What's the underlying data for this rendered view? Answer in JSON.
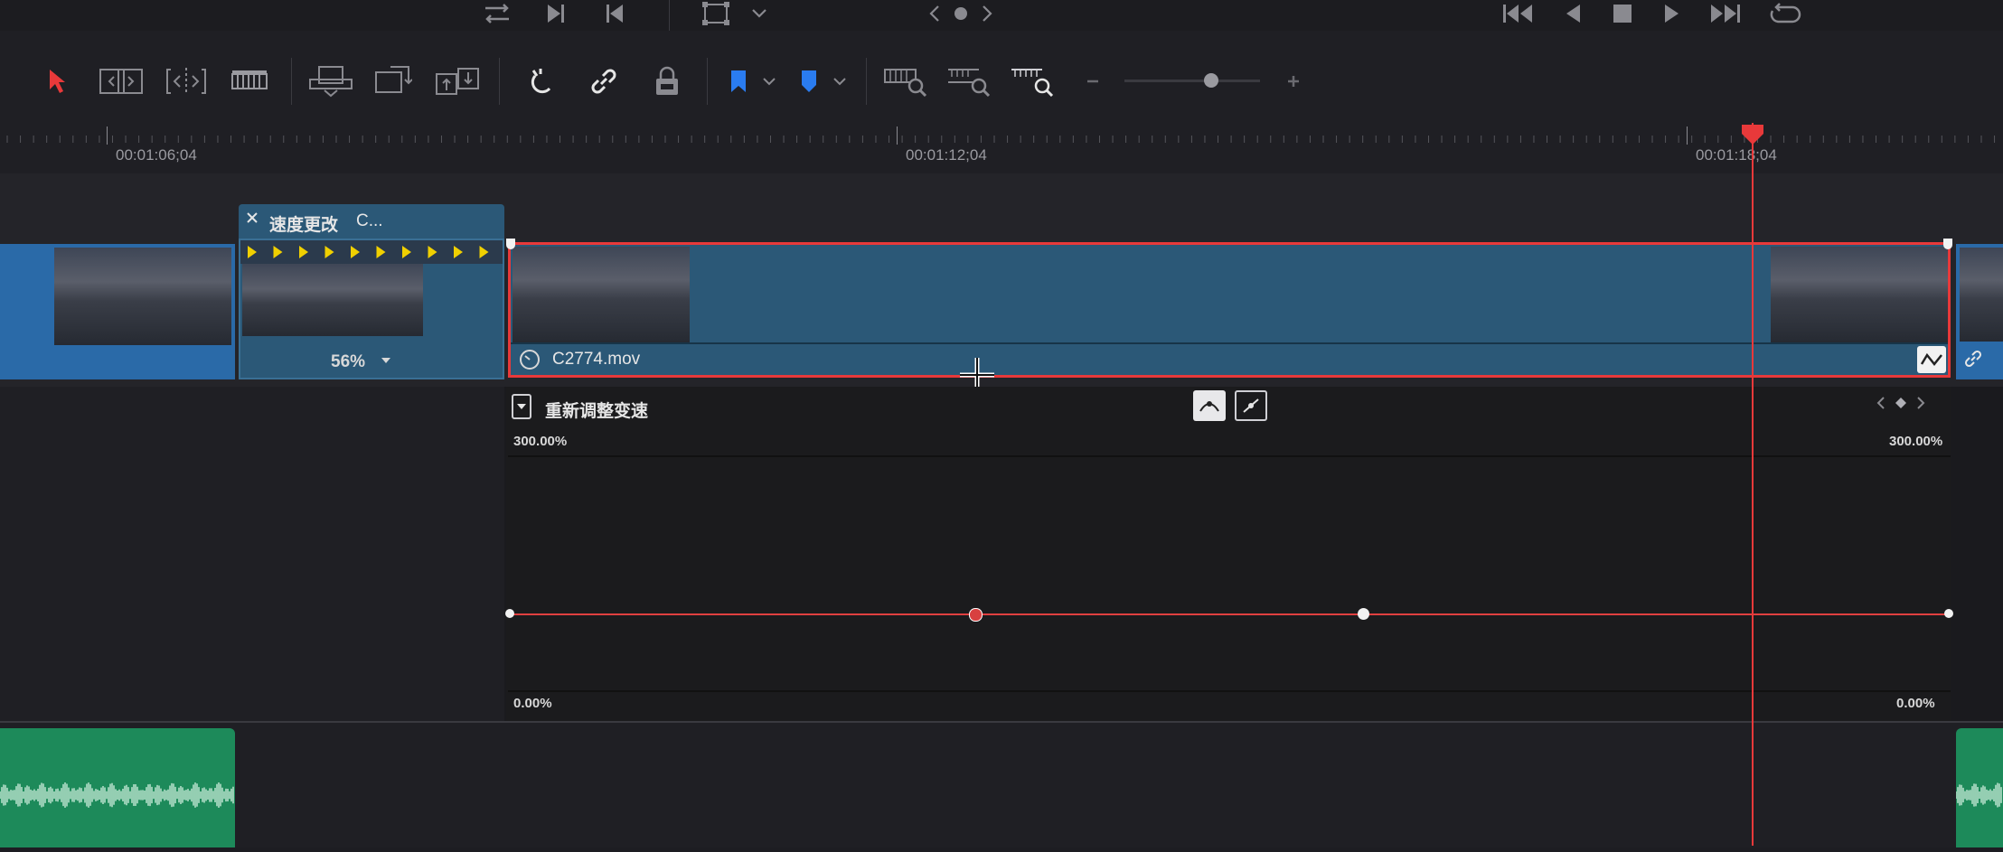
{
  "transport": {
    "icons": [
      "loop-icon",
      "skip-forward-icon",
      "skip-back-icon",
      "crop-icon",
      "chevron-down-icon",
      "prev-icon",
      "dot-icon",
      "next-icon",
      "go-start-icon",
      "play-reverse-icon",
      "stop-icon",
      "play-icon",
      "go-end-icon",
      "loop-playback-icon"
    ]
  },
  "toolbar": {
    "tools": [
      "selection-arrow-icon",
      "trim-edit-icon",
      "dynamic-trim-icon",
      "blade-icon",
      "insert-clip-icon",
      "overwrite-clip-icon",
      "replace-clip-icon",
      "snapping-icon",
      "linked-selection-icon",
      "position-lock-icon",
      "flag-icon",
      "marker-icon",
      "zoom-full-icon",
      "zoom-detail-icon",
      "zoom-custom-icon",
      "zoom-out-icon",
      "zoom-in-icon"
    ],
    "zoom_level": 0.64,
    "accent": "#e8393a",
    "flag_color": "#2a7cf0"
  },
  "ruler": {
    "timecodes": [
      "00:01:06;04",
      "00:01:12;04",
      "00:01:18;04"
    ]
  },
  "clips": {
    "speed_change_header": "速度更改",
    "speed_change_name_short": "C...",
    "speed_percent": "56%",
    "main_clip_name": "C2774.mov"
  },
  "curve": {
    "title": "重新调整变速",
    "top_left": "300.00%",
    "top_right": "300.00%",
    "bottom_left": "0.00%",
    "bottom_right": "0.00%",
    "line_color": "#e04040"
  },
  "colors": {
    "clip_blue": "#2b5877",
    "selection_red": "#e8393a",
    "audio_green": "#1d8a5a",
    "speed_arrow_yellow": "#f0d000"
  }
}
